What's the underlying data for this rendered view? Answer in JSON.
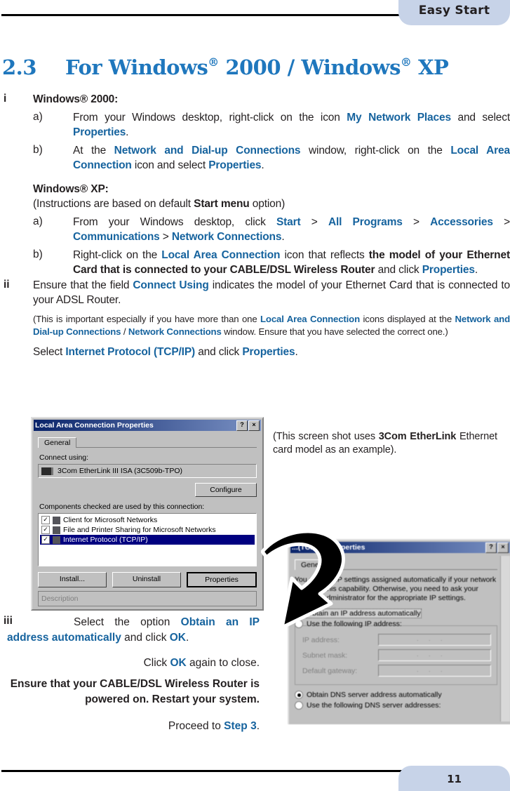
{
  "header": {
    "tab_label": "Easy Start"
  },
  "footer": {
    "page_number": "11"
  },
  "heading": {
    "number": "2.3",
    "title_part1": "For Windows",
    "title_part2": " 2000 / Windows",
    "title_part3": " XP",
    "registered_mark": "®",
    "color": "#1f77bd"
  },
  "colors": {
    "link_blue": "#16639e",
    "heading_blue": "#1f77bd",
    "tab_blue": "#c7d3e8"
  },
  "section_i": {
    "marker": "i",
    "win2000_label": "Windows® 2000:",
    "a_marker": "a)",
    "a_text_1": "From your Windows desktop, right-click on the icon ",
    "a_link_1": "My Network Places",
    "a_text_2": " and select  ",
    "a_link_2": "Properties",
    "a_text_3": ".",
    "b_marker": "b)",
    "b_text_1": "At the ",
    "b_link_1": "Network and Dial-up Connections",
    "b_text_2": " window, right-click on the ",
    "b_link_2": "Local Area Connection",
    "b_text_3": " icon and select  ",
    "b_link_3": "Properties",
    "b_text_4": "."
  },
  "section_xp": {
    "winxp_label": "Windows® XP:",
    "instructions_1": "(Instructions are based on default  ",
    "instructions_bold": "Start menu",
    "instructions_2": "  option)",
    "a_marker": "a)",
    "a_text_1": "From your Windows desktop, click  ",
    "a_link_start": "Start",
    "a_gt_1": "  >  ",
    "a_link_allprograms": "All Programs",
    "a_gt_2": "  >  ",
    "a_link_accessories": "Accessories",
    "a_gt_3": "  >  ",
    "a_link_communications": "Communications",
    "a_gt_4": "  >  ",
    "a_link_netconn": "Network Connections",
    "a_text_end": ".",
    "b_marker": "b)",
    "b_text_1": "Right-click on the ",
    "b_link_1": "Local Area Connection",
    "b_text_2": " icon that reflects ",
    "b_bold_1": "the model of your Ethernet Card that is connected to your CABLE/DSL Wireless Router",
    "b_text_3": " and click ",
    "b_link_2": "Properties",
    "b_text_4": "."
  },
  "section_ii": {
    "marker": "ii",
    "text_1": "Ensure that the field  ",
    "link_1": "Connect Using",
    "text_2": " indicates the model of your Ethernet Card that is connected to your ADSL Router.",
    "note_1": "(This is important especially if you have more than one ",
    "note_link_1": "Local Area Connection",
    "note_2": " icons displayed at the ",
    "note_link_2": "Network and Dial-up Connections",
    "note_3": " / ",
    "note_link_3": "Network Connections",
    "note_4": " window.  Ensure that you have selected the correct one.)",
    "select_1": "Select  ",
    "select_link_1": "Internet Protocol (TCP/IP)",
    "select_2": "  and click  ",
    "select_link_2": "Properties",
    "select_3": "."
  },
  "caption": {
    "text_1": "(This screen shot uses  ",
    "bold": "3Com EtherLink",
    "text_2": " Ethernet card model as an example)."
  },
  "section_iii": {
    "marker": "iii",
    "line1_text_1": "Select the option  ",
    "line1_link_1": "Obtain an IP address automatically",
    "line1_text_2": " and click ",
    "line1_link_2": "OK",
    "line1_text_3": ".",
    "line2_text_1": "Click  ",
    "line2_link_1": "OK",
    "line2_text_2": "  again to close.",
    "line3_bold": "Ensure that your CABLE/DSL Wireless Router is powered on.  Restart your system.",
    "line4_text_1": "Proceed to  ",
    "line4_link_1": "Step 3",
    "line4_text_2": "."
  },
  "dialog1": {
    "title": "Local Area Connection Properties",
    "help_button": "?",
    "close_button": "×",
    "tab_general": "General",
    "connect_using_label": "Connect using:",
    "adapter": "3Com EtherLink III ISA (3C509b-TPO)",
    "configure_button": "Configure",
    "components_label": "Components checked are used by this connection:",
    "components": [
      {
        "label": "Client for Microsoft Networks",
        "checked": true,
        "selected": false
      },
      {
        "label": "File and Printer Sharing for Microsoft Networks",
        "checked": true,
        "selected": false
      },
      {
        "label": "Internet Protocol (TCP/IP)",
        "checked": true,
        "selected": true
      }
    ],
    "install_button": "Install...",
    "uninstall_button": "Uninstall",
    "properties_button": "Properties",
    "description_label": "Description"
  },
  "dialog2": {
    "title": "...(TCP/IP) Properties",
    "help_button": "?",
    "close_button": "×",
    "tab_general": "General",
    "info_text": "You can get IP settings assigned automatically if your network supports this capability. Otherwise, you need to ask your network administrator for the appropriate IP settings.",
    "radio_auto_ip": "Obtain an IP address automatically",
    "radio_manual_ip": "Use the following IP address:",
    "field_ip": "IP address:",
    "field_subnet": "Subnet mask:",
    "field_gateway": "Default gateway:",
    "radio_auto_dns": "Obtain DNS server address automatically",
    "radio_manual_dns": "Use the following DNS server addresses:"
  }
}
